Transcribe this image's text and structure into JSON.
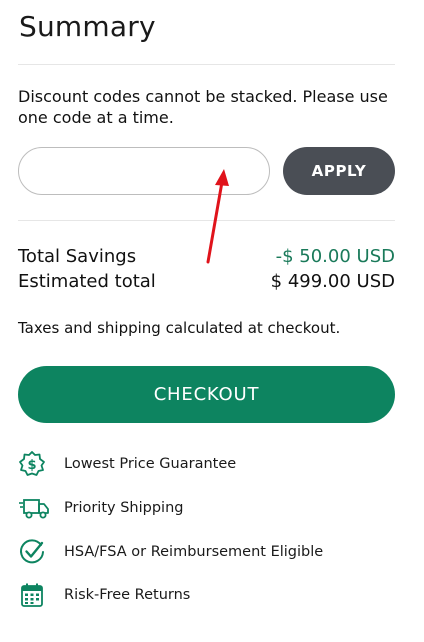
{
  "summary": {
    "title": "Summary",
    "notice": "Discount codes cannot be stacked. Please use one code at a time.",
    "code_input": {
      "value": "",
      "placeholder": ""
    },
    "apply_label": "APPLY",
    "total_savings_label": "Total Savings",
    "total_savings_value": "-$ 50.00 USD",
    "estimated_total_label": "Estimated total",
    "estimated_total_value": "$ 499.00 USD",
    "tax_note": "Taxes and shipping calculated at checkout.",
    "checkout_label": "CHECKOUT"
  },
  "perks": [
    {
      "label": "Lowest Price Guarantee",
      "icon": "dollar-badge-icon"
    },
    {
      "label": "Priority Shipping",
      "icon": "delivery-truck-icon"
    },
    {
      "label": "HSA/FSA or Reimbursement Eligible",
      "icon": "check-circle-icon"
    },
    {
      "label": "Risk-Free Returns",
      "icon": "calendar-icon"
    }
  ],
  "colors": {
    "brand_green": "#0d8460",
    "apply_button": "#4a4e55",
    "savings_text": "#1a7a5a",
    "annotation_arrow": "#e0131b"
  }
}
